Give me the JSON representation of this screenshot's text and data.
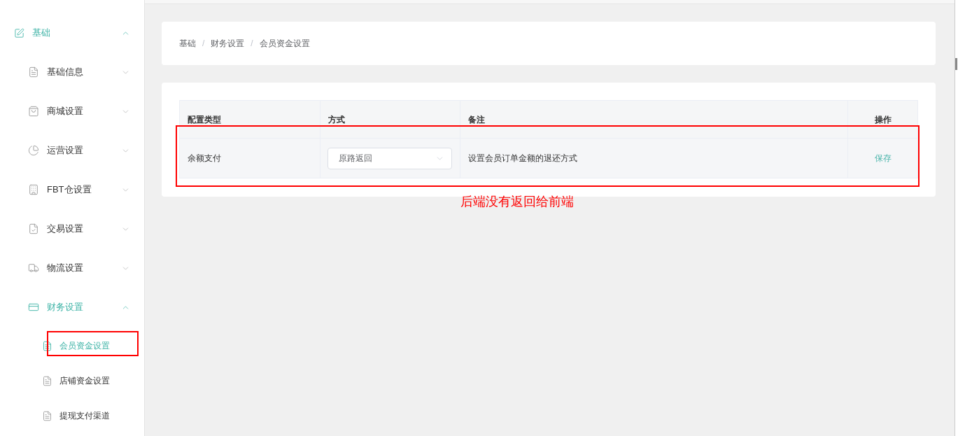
{
  "sidebar": {
    "items": [
      {
        "label": "基础",
        "expanded": true,
        "children": [
          {
            "label": "基础信息",
            "expanded": false
          },
          {
            "label": "商城设置",
            "expanded": false
          },
          {
            "label": "运营设置",
            "expanded": false
          },
          {
            "label": "FBT仓设置",
            "expanded": false
          },
          {
            "label": "交易设置",
            "expanded": false
          },
          {
            "label": "物流设置",
            "expanded": false
          },
          {
            "label": "财务设置",
            "expanded": true,
            "children": [
              {
                "label": "会员资金设置",
                "selected": true,
                "annotated": true
              },
              {
                "label": "店铺资金设置",
                "selected": false,
                "annotated": false
              },
              {
                "label": "提现支付渠道",
                "selected": false,
                "annotated": false
              }
            ]
          }
        ]
      }
    ]
  },
  "breadcrumb": [
    {
      "label": "基础",
      "separator": "/"
    },
    {
      "label": "财务设置",
      "separator": "/"
    },
    {
      "label": "会员资金设置"
    }
  ],
  "table": {
    "columns": [
      {
        "label": "配置类型"
      },
      {
        "label": "方式"
      },
      {
        "label": "备注"
      },
      {
        "label": "操作"
      }
    ],
    "rows": [
      {
        "annotated": true,
        "cells": [
          {
            "kind": "text",
            "text": "余额支付"
          },
          {
            "kind": "select",
            "value": "原路返回"
          },
          {
            "kind": "text",
            "text": "设置会员订单金额的退还方式"
          },
          {
            "kind": "link",
            "text": "保存"
          }
        ]
      }
    ]
  },
  "annotation_note": "后端没有返回给前端"
}
